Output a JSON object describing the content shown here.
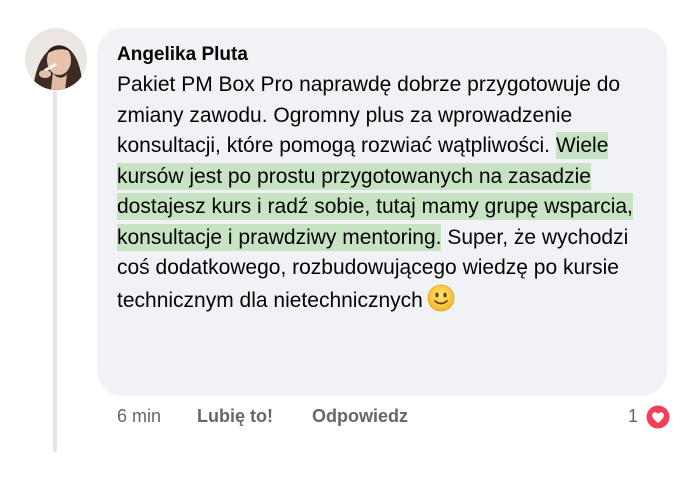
{
  "comment": {
    "author": "Angelika Pluta",
    "text_before": "Pakiet PM Box Pro naprawdę dobrze przygotowuje do zmiany zawodu. Ogromny plus za wprowadzenie konsultacji, które pomogą rozwiać wątpliwości. ",
    "text_highlight": "Wiele kursów jest po prostu przygotowanych na zasadzie dostajesz kurs i radź sobie, tutaj mamy grupę wsparcia, konsultacje i prawdziwy mentoring.",
    "text_after": " Super, że wychodzi coś dodatkowego, rozbudowującego wiedzę po kursie technicznym dla nietechnicznych",
    "emoji": "slightly-smiling-face-icon",
    "highlight_color": "#c7e3c3"
  },
  "footer": {
    "time": "6 min",
    "like_label": "Lubię to!",
    "reply_label": "Odpowiedz",
    "reaction_count": "1",
    "reaction_icon": "heart-reaction-icon"
  },
  "colors": {
    "bubble": "#f0f2f5",
    "meta_text": "#65676b",
    "heart": "#f33e58"
  }
}
